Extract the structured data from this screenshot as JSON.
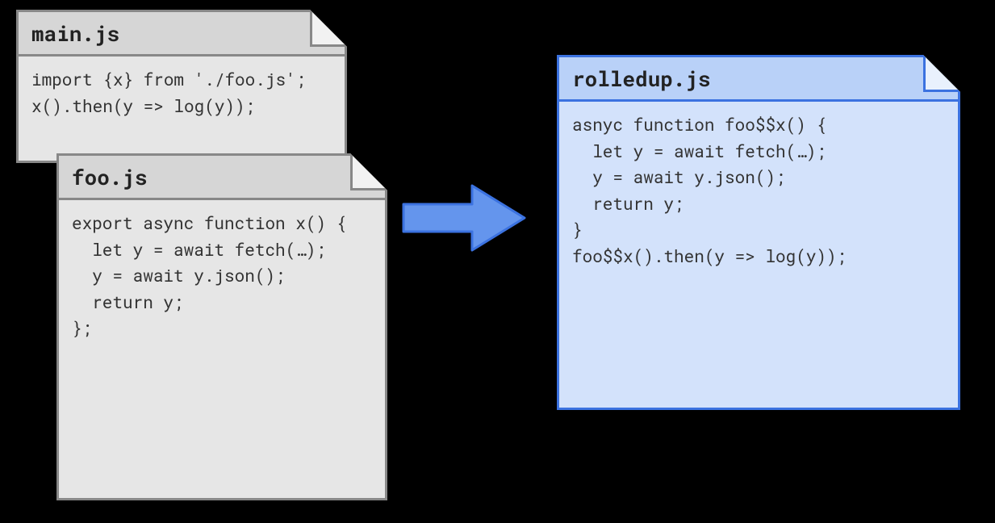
{
  "files": {
    "main": {
      "title": "main.js",
      "code": "import {x} from './foo.js';\nx().then(y => log(y));"
    },
    "foo": {
      "title": "foo.js",
      "code": "export async function x() {\n  let y = await fetch(…);\n  y = await y.json();\n  return y;\n};"
    },
    "rolledup": {
      "title": "rolledup.js",
      "code": "asnyc function foo$$x() {\n  let y = await fetch(…);\n  y = await y.json();\n  return y;\n}\nfoo$$x().then(y => log(y));"
    }
  },
  "colors": {
    "input_border": "#888888",
    "input_fill": "#e6e6e6",
    "input_header": "#d6d6d6",
    "output_border": "#3b72e0",
    "output_fill": "#d3e2fb",
    "output_header": "#b9d1f8",
    "arrow_fill": "#6495ed",
    "arrow_stroke": "#3b72e0"
  },
  "arrow": {
    "direction": "right",
    "meaning": "bundling / rollup transforms inputs into output"
  }
}
